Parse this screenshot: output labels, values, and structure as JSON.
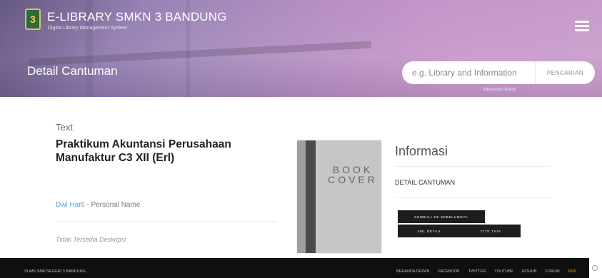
{
  "header": {
    "logo_text": "3",
    "title": "E-LIBRARY SMKN 3 BANDUNG",
    "subtitle": "Digital Library Management System",
    "page_title": "Detail Cantuman",
    "search_placeholder": "e.g. Library and Information",
    "search_button": "PENCARIAN",
    "advanced_search": "Advanced Search"
  },
  "record": {
    "type": "Text",
    "title": "Praktikum Akuntansi Perusahaan Manufaktur C3 XII (Erl)",
    "author": "Dwi Harti",
    "author_role": " - Personal Name",
    "description": "Tidak Tersedia Deskripsi"
  },
  "cover": {
    "text": "BOOK COVER"
  },
  "info": {
    "heading": "Informasi",
    "detail_label": "DETAIL CANTUMAN",
    "back_button": "KEMBALI KE SEBELUMNYA",
    "xml_button": "XML DETAIL",
    "cite_button": "CITE THIS"
  },
  "footer": {
    "copyright": "SLiMS SMK NEGERI 3 BANDUNG",
    "links": [
      "BERANDA DEPAN",
      "FACEBOOK",
      "TWITTER",
      "YOUTUBE",
      "GITHUB",
      "FORUM",
      "RSS"
    ]
  },
  "colors": {
    "header_gradient_start": "#7e6aa6",
    "header_gradient_end": "#c79bca",
    "link": "#5a9fd6",
    "button": "#1d1d1d",
    "rss": "#f0a52a"
  }
}
